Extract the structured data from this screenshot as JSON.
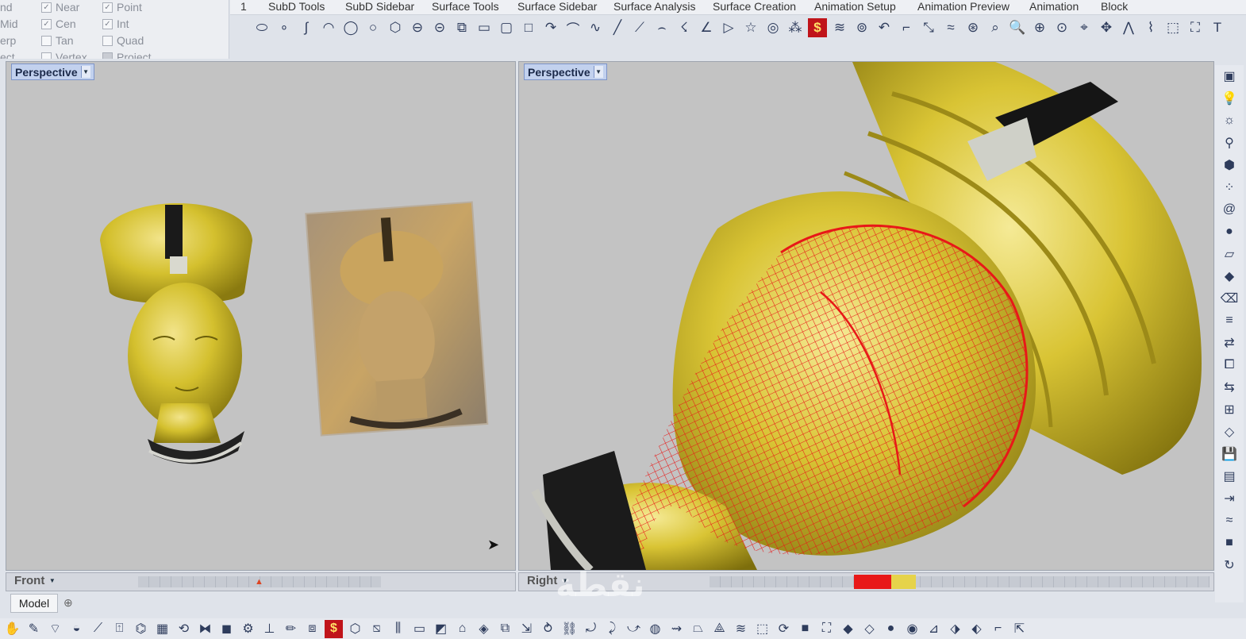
{
  "osnaps": [
    {
      "label": "nd",
      "checked": null
    },
    {
      "label": "Mid",
      "checked": null
    },
    {
      "label": "erp",
      "checked": null
    },
    {
      "label": "ect",
      "checked": null
    },
    {
      "label": "Near",
      "checked": true
    },
    {
      "label": "Cen",
      "checked": true
    },
    {
      "label": "Tan",
      "checked": false
    },
    {
      "label": "Vertex",
      "checked": false
    },
    {
      "label": "Point",
      "checked": true
    },
    {
      "label": "Int",
      "checked": true
    },
    {
      "label": "Quad",
      "checked": false
    },
    {
      "label": "Project",
      "checked": false
    }
  ],
  "tabs": [
    "1",
    "SubD Tools",
    "SubD Sidebar",
    "Surface Tools",
    "Surface Sidebar",
    "Surface Analysis",
    "Surface Creation",
    "Animation Setup",
    "Animation Preview",
    "Animation",
    "Block"
  ],
  "viewports": {
    "left": {
      "title": "Perspective"
    },
    "right": {
      "title": "Perspective"
    }
  },
  "status_left": "Front",
  "status_right": "Right",
  "model_tab": "Model",
  "watermark": "نقطة",
  "colors": {
    "gold": "#d8c43a",
    "mesh": "#e81818",
    "viewport_bg": "#c3c3c3"
  }
}
